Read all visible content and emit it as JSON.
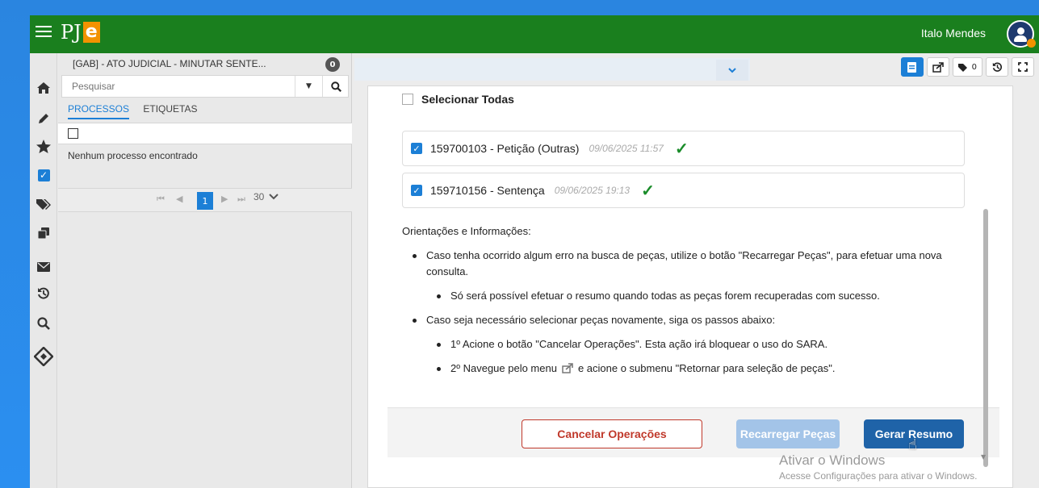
{
  "app": {
    "logo_text": "PJ",
    "logo_accent": "e",
    "user_name": "Italo Mendes",
    "brand_color": "#1a7f1e",
    "accent_color": "#f29200"
  },
  "rail": {
    "icons": [
      "home-icon",
      "pencil-icon",
      "star-icon",
      "checkbox-icon",
      "tags-icon",
      "copy-icon",
      "envelope-icon",
      "history-icon",
      "search-icon",
      "diamond-nav-icon"
    ]
  },
  "process_panel": {
    "title": "[GAB] - ATO JUDICIAL - MINUTAR SENTE...",
    "count": "0",
    "search_placeholder": "Pesquisar",
    "tabs": [
      "PROCESSOS",
      "ETIQUETAS"
    ],
    "empty_message": "Nenhum processo encontrado",
    "pager": {
      "current_page": "1",
      "page_size": "30"
    }
  },
  "toolbar": {
    "tags_count": "0"
  },
  "dialog": {
    "select_all_label": "Selecionar Todas",
    "documents": [
      {
        "label": "159700103 - Petição (Outras)",
        "date": "09/06/2025 11:57",
        "checked": true
      },
      {
        "label": "159710156 - Sentença",
        "date": "09/06/2025 19:13",
        "checked": true
      }
    ],
    "info_title": "Orientações e Informações:",
    "info_bullet_1": "Caso tenha ocorrido algum erro na busca de peças, utilize o botão \"Recarregar Peças\", para efetuar uma nova consulta.",
    "info_sub_1": "Só será possível efetuar o resumo quando todas as peças forem recuperadas com sucesso.",
    "info_bullet_2": "Caso seja necessário selecionar peças novamente, siga os passos abaixo:",
    "info_sub_2": "1º Acione o botão \"Cancelar Operações\". Esta ação irá bloquear o uso do SARA.",
    "info_sub_3_pre": "2º Navegue pelo menu",
    "info_sub_3_post": "e acione o submenu \"Retornar para seleção de peças\".",
    "buttons": {
      "cancel": "Cancelar Operações",
      "reload": "Recarregar Peças",
      "generate": "Gerar Resumo"
    }
  },
  "watermark": {
    "line1": "Ativar o Windows",
    "line2": "Acesse Configurações para ativar o Windows."
  }
}
